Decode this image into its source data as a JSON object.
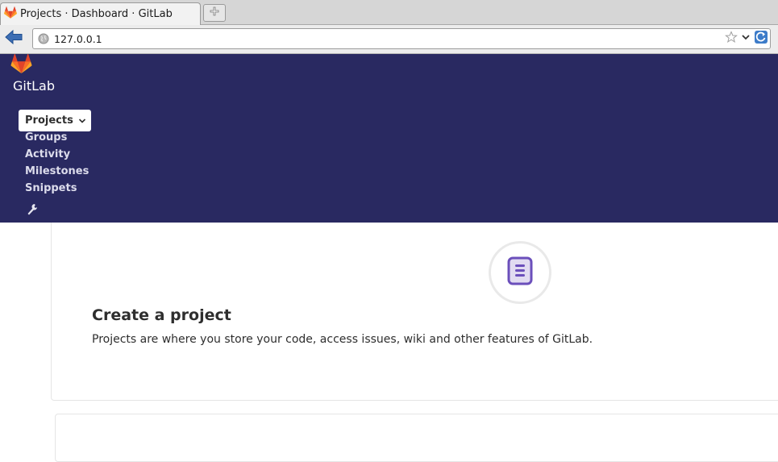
{
  "browser": {
    "tab_title": "Projects · Dashboard · GitLab",
    "url": "127.0.0.1"
  },
  "header": {
    "brand": "GitLab",
    "nav": {
      "projects": "Projects",
      "groups": "Groups",
      "activity": "Activity",
      "milestones": "Milestones",
      "snippets": "Snippets"
    }
  },
  "empty_state": {
    "title": "Create a project",
    "description": "Projects are where you store your code, access issues, wiki and other features of GitLab."
  },
  "colors": {
    "header_bg": "#292961",
    "accent_purple": "#6b4fbb",
    "logo_orange": "#e24329"
  }
}
